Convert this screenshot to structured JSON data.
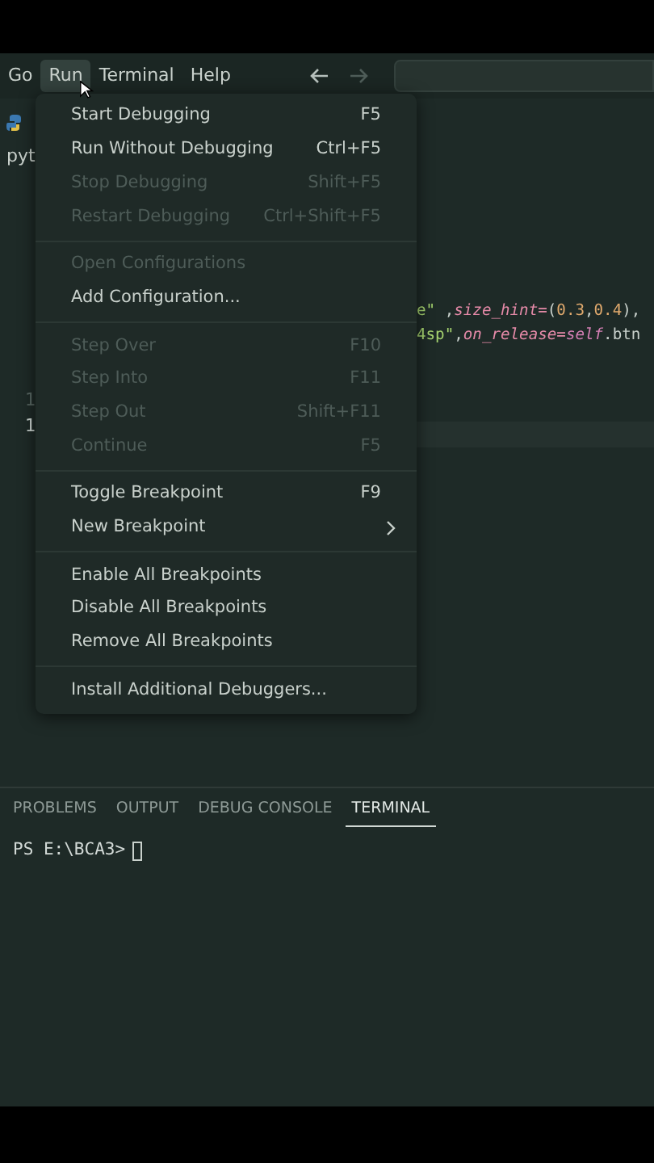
{
  "menubar": {
    "items": [
      {
        "label": "Go",
        "selected": false
      },
      {
        "label": "Run",
        "selected": true
      },
      {
        "label": "Terminal",
        "selected": false
      },
      {
        "label": "Help",
        "selected": false
      }
    ],
    "back_disabled": false,
    "forward_disabled": true
  },
  "sidebar": {
    "text": "pyt"
  },
  "editor": {
    "line_numbers": [
      {
        "label": "1",
        "current": false
      },
      {
        "label": "1",
        "current": true
      }
    ],
    "code_lines": [
      [
        {
          "kind": "string",
          "text": "e\""
        },
        {
          "kind": "punct",
          "text": " ,"
        },
        {
          "kind": "param",
          "text": "size_hint"
        },
        {
          "kind": "op",
          "text": "="
        },
        {
          "kind": "punct",
          "text": "("
        },
        {
          "kind": "number",
          "text": "0.3"
        },
        {
          "kind": "punct",
          "text": ","
        },
        {
          "kind": "number",
          "text": "0.4"
        },
        {
          "kind": "punct",
          "text": "),"
        }
      ],
      [
        {
          "kind": "string",
          "text": "4sp\""
        },
        {
          "kind": "punct",
          "text": ","
        },
        {
          "kind": "param",
          "text": "on_release"
        },
        {
          "kind": "op",
          "text": "="
        },
        {
          "kind": "self",
          "text": "self"
        },
        {
          "kind": "punct",
          "text": ".btn"
        }
      ]
    ]
  },
  "run_menu": {
    "groups": [
      [
        {
          "label": "Start Debugging",
          "shortcut": "F5",
          "disabled": false,
          "submenu": false
        },
        {
          "label": "Run Without Debugging",
          "shortcut": "Ctrl+F5",
          "disabled": false,
          "submenu": false
        },
        {
          "label": "Stop Debugging",
          "shortcut": "Shift+F5",
          "disabled": true,
          "submenu": false
        },
        {
          "label": "Restart Debugging",
          "shortcut": "Ctrl+Shift+F5",
          "disabled": true,
          "submenu": false
        }
      ],
      [
        {
          "label": "Open Configurations",
          "disabled": true,
          "submenu": false
        },
        {
          "label": "Add Configuration...",
          "disabled": false,
          "submenu": false
        }
      ],
      [
        {
          "label": "Step Over",
          "shortcut": "F10",
          "disabled": true,
          "submenu": false
        },
        {
          "label": "Step Into",
          "shortcut": "F11",
          "disabled": true,
          "submenu": false
        },
        {
          "label": "Step Out",
          "shortcut": "Shift+F11",
          "disabled": true,
          "submenu": false
        },
        {
          "label": "Continue",
          "shortcut": "F5",
          "disabled": true,
          "submenu": false
        }
      ],
      [
        {
          "label": "Toggle Breakpoint",
          "shortcut": "F9",
          "disabled": false,
          "submenu": false
        },
        {
          "label": "New Breakpoint",
          "disabled": false,
          "submenu": true
        }
      ],
      [
        {
          "label": "Enable All Breakpoints",
          "disabled": false,
          "submenu": false
        },
        {
          "label": "Disable All Breakpoints",
          "disabled": false,
          "submenu": false
        },
        {
          "label": "Remove All Breakpoints",
          "disabled": false,
          "submenu": false
        }
      ],
      [
        {
          "label": "Install Additional Debuggers...",
          "disabled": false,
          "submenu": false
        }
      ]
    ]
  },
  "panel": {
    "tabs": [
      {
        "label": "PROBLEMS",
        "selected": false
      },
      {
        "label": "OUTPUT",
        "selected": false
      },
      {
        "label": "DEBUG CONSOLE",
        "selected": false
      },
      {
        "label": "TERMINAL",
        "selected": true
      }
    ],
    "prompt": "PS E:\\BCA3>"
  }
}
